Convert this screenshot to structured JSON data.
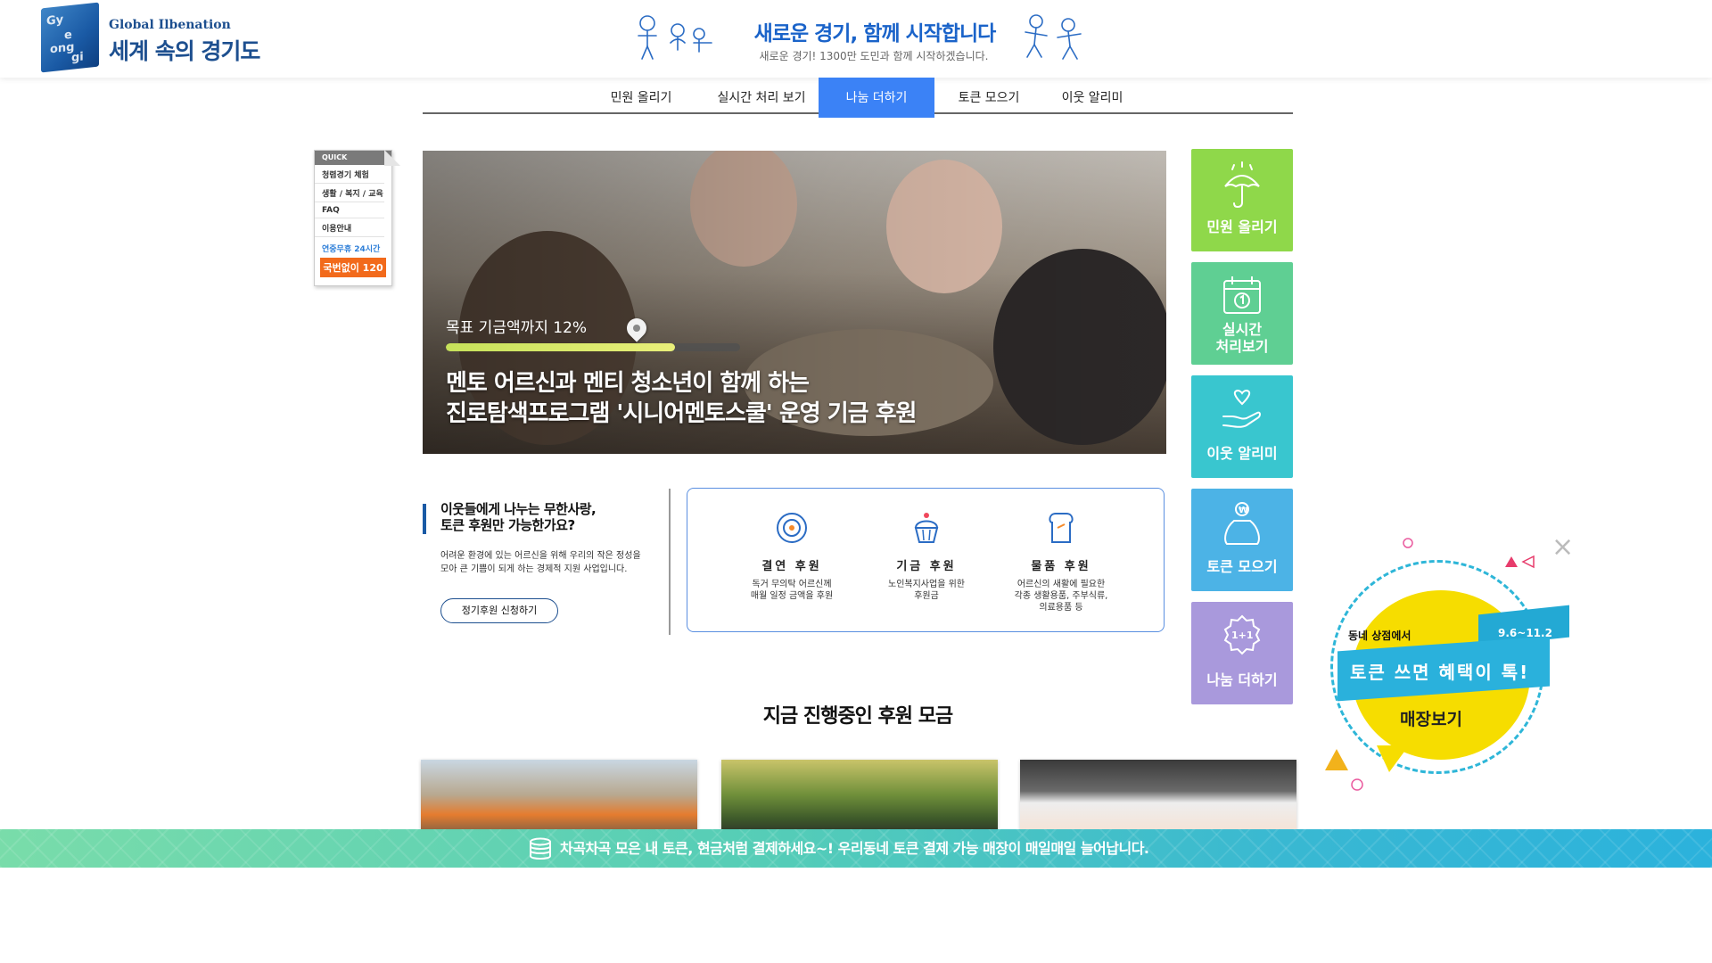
{
  "header": {
    "logo_en": "Global Ilbenation",
    "logo_ko": "세계 속의 경기도",
    "slogan_main": "새로운 경기, 함께 시작합니다",
    "slogan_sub": "새로운 경기! 1300만 도민과 함께 시작하겠습니다."
  },
  "nav": {
    "items": [
      {
        "label": "민원 올리기"
      },
      {
        "label": "실시간 처리 보기"
      },
      {
        "label": "나눔 더하기",
        "active": true
      },
      {
        "label": "토큰 모으기"
      },
      {
        "label": "이웃 알리미"
      }
    ]
  },
  "quick": {
    "title": "QUICK",
    "items": [
      "청렴경기 체험",
      "생활 / 복지 / 교육",
      "FAQ",
      "이용안내"
    ],
    "hours": "연중무휴 24시간",
    "call": "국번없이 120"
  },
  "hero": {
    "goal_text": "목표 기금액까지 12%",
    "goal_progress": 12,
    "title_line1": "멘토 어르신과 멘티 청소년이 함께 하는",
    "title_line2": "진로탐색프로그램 '시니어멘토스쿨' 운영 기금 후원"
  },
  "side_tiles": [
    {
      "label": "민원 올리기",
      "color": "#8fd84a",
      "icon": "umbrella-icon"
    },
    {
      "label": "실시간\n처리보기",
      "color": "#5fcf93",
      "icon": "calendar-icon"
    },
    {
      "label": "이웃 알리미",
      "color": "#39c6cf",
      "icon": "hand-heart-icon"
    },
    {
      "label": "토큰 모으기",
      "color": "#4cb3e6",
      "icon": "money-bag-icon"
    },
    {
      "label": "나눔 더하기",
      "color": "#a999dc",
      "icon": "one-plus-one-icon"
    }
  ],
  "info": {
    "title_line1": "이웃들에게 나누는 무한사랑,",
    "title_line2": "토큰 후원만 가능한가요?",
    "desc": "어려운 환경에 있는 어르신을 위해 우리의 작은 정성을 모아 큰 기쁨이 되게 하는 경제적 지원 사업입니다.",
    "button": "정기후원 신청하기"
  },
  "donation_types": [
    {
      "name": "결연 후원",
      "desc": "독거 무의탁 어르신께\n매월 일정 금액을 후원",
      "icon": "coin-icon"
    },
    {
      "name": "기금 후원",
      "desc": "노인복지사업을 위한\n후원금",
      "icon": "cupcake-icon"
    },
    {
      "name": "물품 후원",
      "desc": "어르신의 새활에 필요한\n각종 생활용품, 주부식류,\n의료용품 등",
      "icon": "bread-icon"
    }
  ],
  "section": {
    "title": "지금 진행중인 후원 모금"
  },
  "ticker": {
    "text": "차곡차곡 모은 내 토큰, 현금처럼 결제하세요~! 우리동네 토큰 결제 가능 매장이 매일매일 늘어납니다."
  },
  "promo": {
    "shop_text": "동네 상점에서",
    "date": "9.6~11.2",
    "headline": "토큰 쓰면 혜택이 톡!",
    "store_button": "매장보기"
  }
}
